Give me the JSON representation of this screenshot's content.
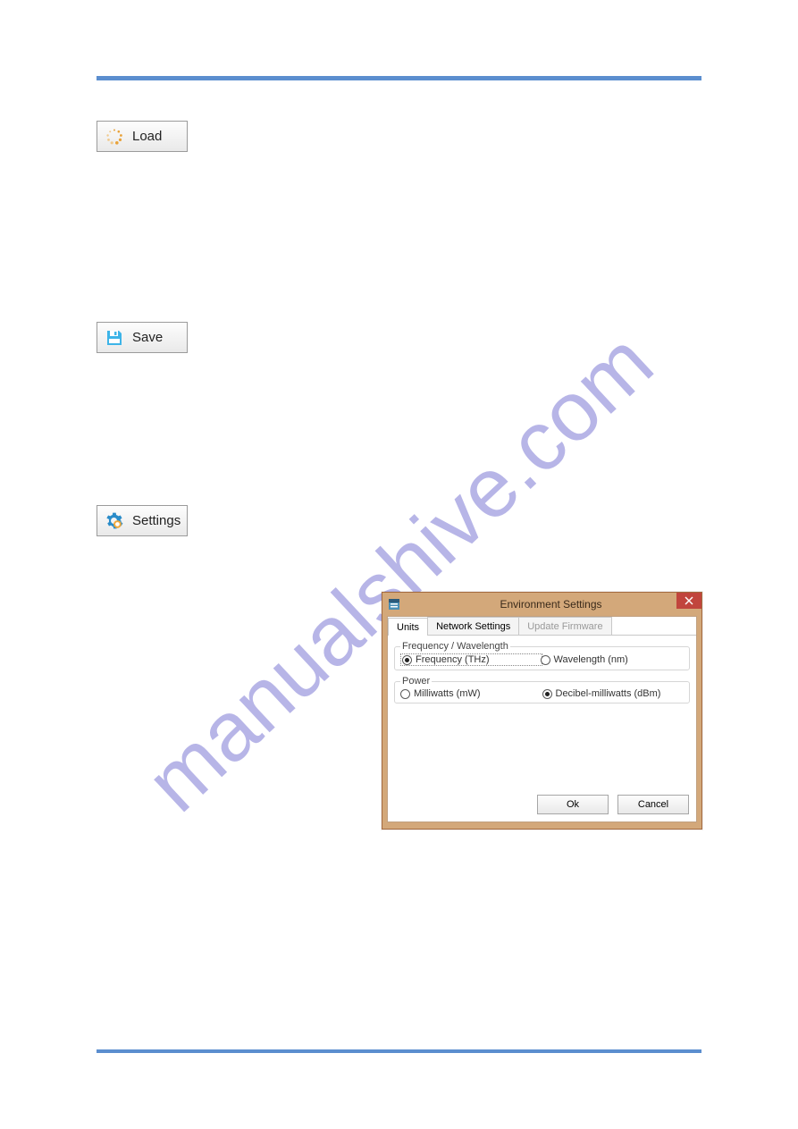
{
  "watermark": "manualshive.com",
  "toolbar": {
    "load_label": "Load",
    "save_label": "Save",
    "settings_label": "Settings"
  },
  "dialog": {
    "title": "Environment Settings",
    "tabs": {
      "units": "Units",
      "network": "Network Settings",
      "firmware": "Update Firmware"
    },
    "groups": {
      "freq_legend": "Frequency / Wavelength",
      "freq_opt1": "Frequency (THz)",
      "freq_opt2": "Wavelength (nm)",
      "power_legend": "Power",
      "power_opt1": "Milliwatts (mW)",
      "power_opt2": "Decibel-milliwatts (dBm)"
    },
    "ok_label": "Ok",
    "cancel_label": "Cancel"
  }
}
